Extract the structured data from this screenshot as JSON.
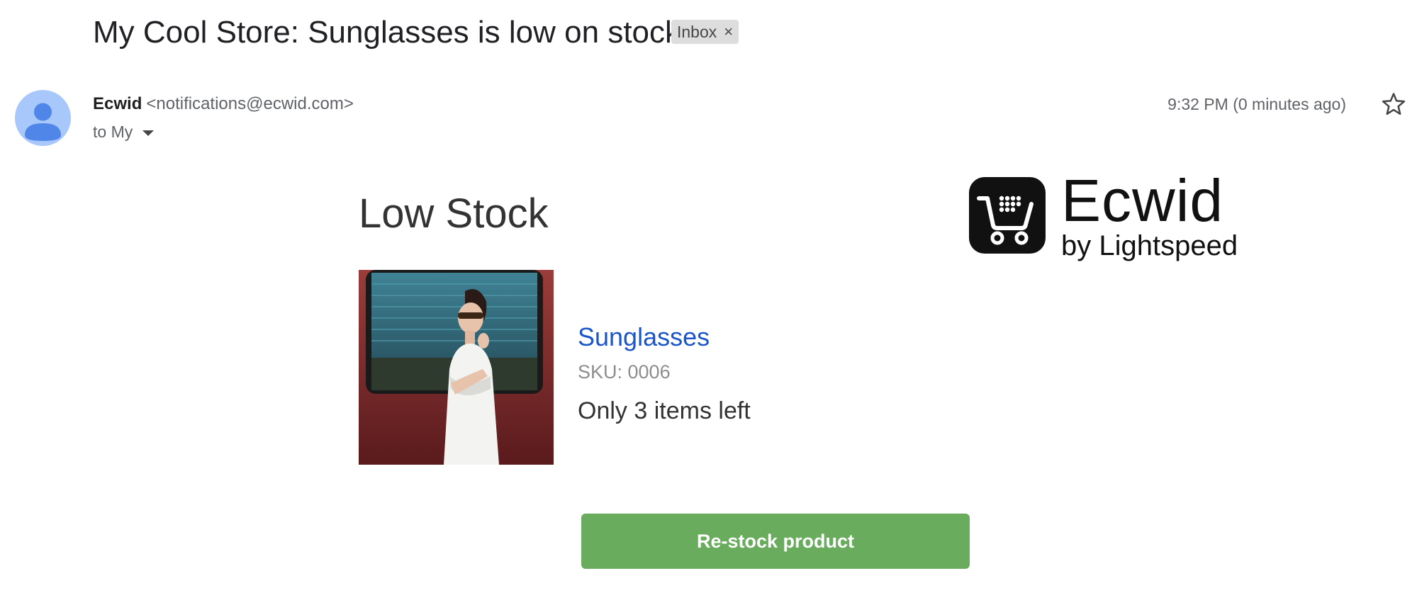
{
  "email": {
    "subject": "My Cool Store: Sunglasses is low on stock",
    "label": "Inbox",
    "label_remove_glyph": "×",
    "sender_name": "Ecwid",
    "sender_address": "<notifications@ecwid.com>",
    "recipient": "to My",
    "timestamp": "9:32 PM (0 minutes ago)",
    "icons": [
      "person-avatar-icon",
      "chevron-down-icon",
      "star-icon",
      "close-icon"
    ]
  },
  "body": {
    "heading": "Low Stock",
    "logo": {
      "name": "Ecwid",
      "tagline": "by Lightspeed",
      "icon": "shopping-cart-icon"
    },
    "product": {
      "name": "Sunglasses",
      "sku": "SKU: 0006",
      "stock_message": "Only 3 items left",
      "image": "woman-in-white-dress-wearing-sunglasses-photo"
    },
    "button_label": "Re-stock product"
  },
  "colors": {
    "link": "#1a56c9",
    "button": "#6aac5e",
    "avatar": "#a8c7fa",
    "chip": "#dddddd"
  }
}
